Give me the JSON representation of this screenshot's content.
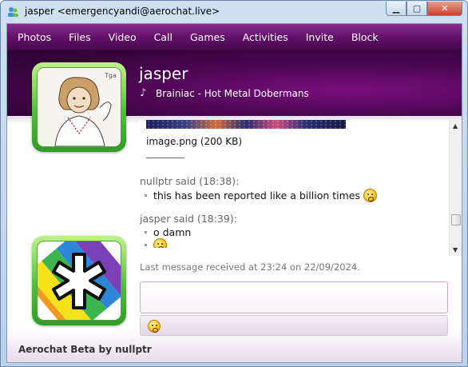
{
  "window": {
    "title": "jasper <emergencyandi@aerochat.live>",
    "minimize_glyph": "▁",
    "maximize_glyph": "▢",
    "close_glyph": "✕"
  },
  "menu": {
    "items": [
      "Photos",
      "Files",
      "Video",
      "Call",
      "Games",
      "Activities",
      "Invite",
      "Block"
    ]
  },
  "contact": {
    "name": "jasper",
    "now_playing": "Brainiac - Hot Metal Dobermans",
    "avatar_signature": "Tga"
  },
  "chat": {
    "attachment_name": "image.png (200 KB)",
    "messages": [
      {
        "header": "nullptr said (18:38):",
        "lines": [
          {
            "text": "this has been reported like a billion times",
            "emoji": "crying-laugh-icon"
          }
        ]
      },
      {
        "header": "jasper said (18:39):",
        "lines": [
          {
            "text": "o damn",
            "emoji": ""
          },
          {
            "text": "",
            "emoji": "crying-laugh-icon"
          }
        ]
      }
    ],
    "status": "Last message received at 23:24 on 22/09/2024."
  },
  "input": {
    "value": "",
    "placeholder": ""
  },
  "footer": {
    "text": "Aerochat Beta by nullptr"
  },
  "colors": {
    "menu_bar": "#5c0e63",
    "avatar_frame": "#4fc03a",
    "accent": "#c9a8cf"
  }
}
